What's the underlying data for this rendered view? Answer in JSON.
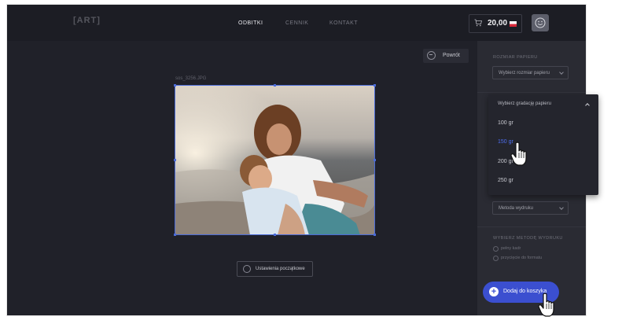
{
  "logo": "[ART]",
  "nav": [
    {
      "label": "ODBITKI"
    },
    {
      "label": "CENNIK"
    },
    {
      "label": "KONTAKT"
    }
  ],
  "cart": {
    "amount": "20,00",
    "icon": "cart-icon"
  },
  "back_button": {
    "label": "Powrót"
  },
  "photo": {
    "filename": "sos_3256.JPG"
  },
  "reset_button": {
    "label": "Ustawienia początkowe"
  },
  "sidebar": {
    "paper_size_title": "ROZMIAR PAPIERU",
    "paper_size_select": "Wybierz rozmiar papieru",
    "print_method_select": "Metoda wydruku",
    "print_method_title": "WYBIERZ METODĘ WYDRUKU",
    "radio_options": [
      {
        "label": "pełny kadr"
      },
      {
        "label": "przycięcie do formatu"
      }
    ]
  },
  "add_to_cart": {
    "label": "Dodaj do koszyka"
  },
  "dropdown": {
    "header": "Wybierz gradację papieru",
    "options": [
      {
        "label": "100 gr"
      },
      {
        "label": "150 gr"
      },
      {
        "label": "200 gr"
      },
      {
        "label": "250 gr"
      }
    ],
    "selected_index": 1
  },
  "colors": {
    "accent": "#3b4fd0",
    "selected_option": "#4e6ef0",
    "background": "#202129",
    "sidebar": "#2a2b33"
  }
}
